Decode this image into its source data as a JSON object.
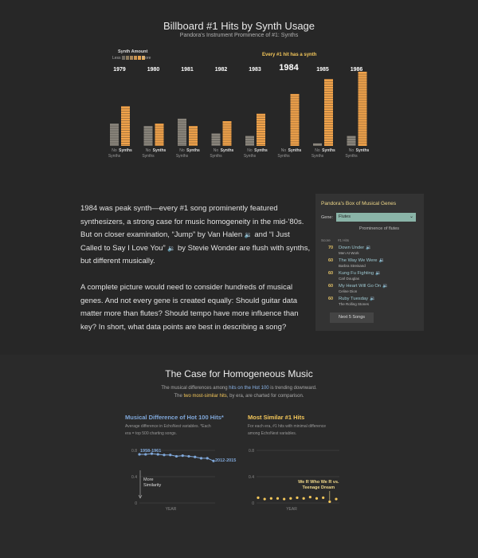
{
  "header": {
    "title": "Billboard #1 Hits by Synth Usage",
    "subtitle": "Pandora's Instrument Prominence of #1: Synths"
  },
  "legend": {
    "title": "Synth Amount",
    "less": "Less",
    "more": "More",
    "swatches": [
      "#6e6a62",
      "#8a7a5e",
      "#a8865a",
      "#c89352",
      "#e3a04e",
      "#f2b04e"
    ]
  },
  "annotation": "Every #1 hit has a synth",
  "colors": {
    "no_synth": "#8a857c",
    "synth": "#f0a24a",
    "blue": "#7fa7d9",
    "yellow": "#f4c75a"
  },
  "chart_data": [
    {
      "type": "bar",
      "title": "Billboard #1 Hits by Synth Usage",
      "categories": [
        "1979",
        "1980",
        "1981",
        "1982",
        "1983",
        "1984",
        "1985",
        "1986"
      ],
      "series": [
        {
          "name": "No Synths",
          "values": [
            9,
            8,
            11,
            5,
            4,
            0,
            1,
            4
          ]
        },
        {
          "name": "Synths",
          "values": [
            16,
            9,
            8,
            10,
            13,
            21,
            27,
            30
          ]
        }
      ],
      "highlight": "1984",
      "bar_labels": {
        "no": "No",
        "no2": "Synths",
        "synths": "Synths"
      }
    },
    {
      "type": "line",
      "title": "Musical Difference of Hot 100 Hits*",
      "ylim": [
        0,
        0.8
      ],
      "yticks": [
        "0.8",
        "0.4",
        "0"
      ],
      "xlabel": "YEAR",
      "values": [
        0.74,
        0.74,
        0.75,
        0.74,
        0.73,
        0.73,
        0.71,
        0.72,
        0.71,
        0.7,
        0.68,
        0.68,
        0.64
      ],
      "start_label": "1958-1961",
      "end_label": "2012-2015",
      "note": [
        "More",
        "Similarity"
      ]
    },
    {
      "type": "scatter",
      "title": "Most Similar #1 Hits",
      "ylim": [
        0,
        0.8
      ],
      "yticks": [
        "0.8",
        "0.4",
        "0"
      ],
      "xlabel": "YEAR",
      "values": [
        0.08,
        0.06,
        0.07,
        0.07,
        0.06,
        0.07,
        0.08,
        0.07,
        0.09,
        0.07,
        0.08,
        0.02,
        0.06
      ],
      "callout": [
        "We R Who We R vs.",
        "Teenage Dream"
      ],
      "callout_index": 11
    }
  ],
  "paragraphs": {
    "p1_a": "1984 was peak synth—every #1 song prominently featured synthesizers, a strong case for music homogeneity in the mid-’80s. But on closer examination, “Jump” by Van Halen",
    "p1_b": "and “I Just Called to Say I Love You”",
    "p1_c": "by Stevie Wonder are flush with synths, but different musically.",
    "p2": "A complete picture would need to consider hundreds of musical genes. And not every gene is created equally: Should guitar data matter more than flutes? Should tempo have more influence than key? In short, what data points are best in describing a song?",
    "speaker": "🔉"
  },
  "panel": {
    "title": "Pandora's Box of Musical Genes",
    "gene_label": "Gene:",
    "gene_value": "Flutes",
    "chevron": "⌄",
    "prominence": "Prominence of flutes",
    "col_score": "Score",
    "col_hits": "#1 Hits",
    "songs": [
      {
        "score": "70",
        "title": "Down Under",
        "artist": "Men At Work"
      },
      {
        "score": "60",
        "title": "The Way We Were",
        "artist": "Barbra Streisand"
      },
      {
        "score": "60",
        "title": "Kung Fu Fighting",
        "artist": "Carl Douglas"
      },
      {
        "score": "60",
        "title": "My Heart Will Go On",
        "artist": "Celine Dion"
      },
      {
        "score": "60",
        "title": "Ruby Tuesday",
        "artist": "The Rolling Stones"
      }
    ],
    "next_button": "Next 5 Songs"
  },
  "section": {
    "title": "The Case for Homogeneous Music",
    "sub1_a": "The musical differences among",
    "sub1_hl": "hits on the Hot 100",
    "sub1_b": "is trending downward.",
    "sub2_a": "The",
    "sub2_hl": "two most-similar hits",
    "sub2_b": ", by era, are charted for comparison."
  },
  "left_chart": {
    "desc1": "Average difference in EchoNest variables. *Each",
    "desc2": "era = top 500 charting songs."
  },
  "right_chart": {
    "desc1": "For each era, #1 hits with minimal difference",
    "desc2": "among EchoNest variables."
  }
}
